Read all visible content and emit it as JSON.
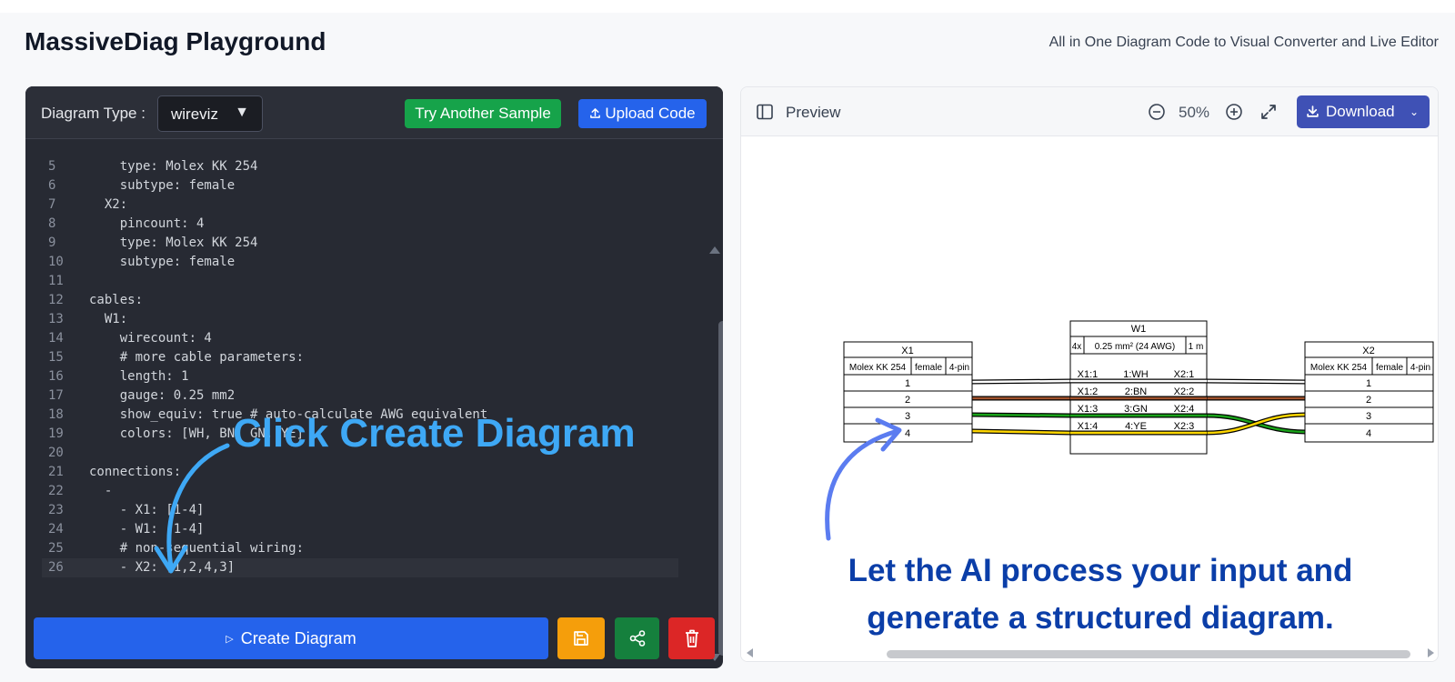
{
  "app": {
    "title": "MassiveDiag Playground",
    "subtitle": "All in One Diagram Code to Visual Converter and Live Editor"
  },
  "editor": {
    "diagram_type_label": "Diagram Type :",
    "diagram_type_value": "wireviz",
    "try_sample_label": "Try Another Sample",
    "upload_label": "Upload Code",
    "create_label": "Create Diagram",
    "code_lines": [
      {
        "n": "5",
        "text": "    type: Molex KK 254"
      },
      {
        "n": "6",
        "text": "    subtype: female"
      },
      {
        "n": "7",
        "text": "  X2:"
      },
      {
        "n": "8",
        "text": "    pincount: 4"
      },
      {
        "n": "9",
        "text": "    type: Molex KK 254"
      },
      {
        "n": "10",
        "text": "    subtype: female"
      },
      {
        "n": "11",
        "text": ""
      },
      {
        "n": "12",
        "text": "cables:"
      },
      {
        "n": "13",
        "text": "  W1:"
      },
      {
        "n": "14",
        "text": "    wirecount: 4"
      },
      {
        "n": "15",
        "text": "    # more cable parameters:"
      },
      {
        "n": "16",
        "text": "    length: 1"
      },
      {
        "n": "17",
        "text": "    gauge: 0.25 mm2"
      },
      {
        "n": "18",
        "text": "    show_equiv: true # auto-calculate AWG equivalent"
      },
      {
        "n": "19",
        "text": "    colors: [WH, BN, GN, YE]"
      },
      {
        "n": "20",
        "text": ""
      },
      {
        "n": "21",
        "text": "connections:"
      },
      {
        "n": "22",
        "text": "  -"
      },
      {
        "n": "23",
        "text": "    - X1: [1-4]"
      },
      {
        "n": "24",
        "text": "    - W1: [1-4]"
      },
      {
        "n": "25",
        "text": "    # non-sequential wiring:"
      },
      {
        "n": "26",
        "text": "    - X2: [1,2,4,3]"
      }
    ]
  },
  "hints": {
    "create": "Click Create Diagram",
    "ai_line1": "Let the AI process your input and",
    "ai_line2": "generate a structured diagram."
  },
  "preview": {
    "label": "Preview",
    "zoom": "50%",
    "download_label": "Download"
  },
  "diagram": {
    "x1": {
      "name": "X1",
      "type": "Molex KK 254",
      "subtype": "female",
      "pins_label": "4-pin",
      "pins": [
        "1",
        "2",
        "3",
        "4"
      ]
    },
    "x2": {
      "name": "X2",
      "type": "Molex KK 254",
      "subtype": "female",
      "pins_label": "4-pin",
      "pins": [
        "1",
        "2",
        "3",
        "4"
      ]
    },
    "w1": {
      "name": "W1",
      "count": "4x",
      "gauge": "0.25 mm² (24 AWG)",
      "length": "1 m",
      "rows": [
        {
          "from": "X1:1",
          "wire": "1:WH",
          "to": "X2:1"
        },
        {
          "from": "X1:2",
          "wire": "2:BN",
          "to": "X2:2"
        },
        {
          "from": "X1:3",
          "wire": "3:GN",
          "to": "X2:4"
        },
        {
          "from": "X1:4",
          "wire": "4:YE",
          "to": "X2:3"
        }
      ]
    },
    "wire_colors": {
      "WH": "#ffffff",
      "BN": "#a0522d",
      "GN": "#1aa31a",
      "YE": "#ffd700"
    }
  },
  "colors": {
    "primary": "#2563eb",
    "success": "#16a34a",
    "warning": "#f59e0b",
    "danger": "#dc2626",
    "download": "#3f51b5",
    "hint_create": "#3ea8f5",
    "hint_ai": "#0b3ea8"
  }
}
